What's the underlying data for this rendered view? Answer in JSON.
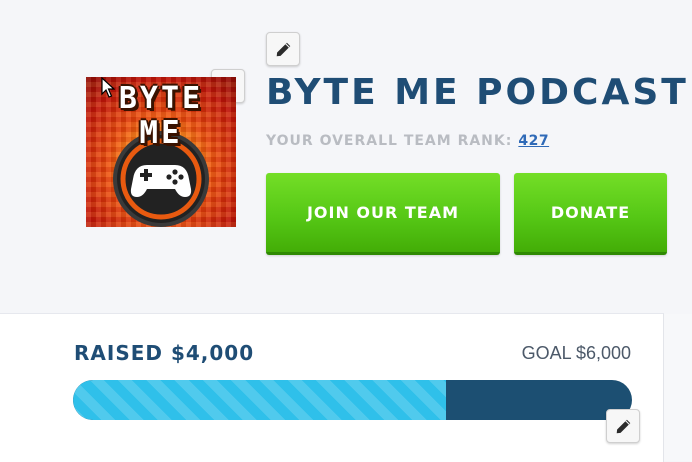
{
  "team": {
    "logo_text": [
      "BYTE",
      "ME"
    ],
    "name": "BYTE ME PODCAST",
    "rank_label": "YOUR OVERALL TEAM RANK:",
    "rank_value": "427"
  },
  "actions": {
    "join_label": "JOIN OUR TEAM",
    "donate_label": "DONATE"
  },
  "fundraising": {
    "raised_label": "RAISED $4,000",
    "goal_label": "GOAL $6,000",
    "raised_amount": 4000,
    "goal_amount": 6000,
    "progress_fraction": 0.667
  },
  "icons": {
    "edit": "pencil-icon",
    "logo_emblem": "gamepad-icon"
  },
  "colors": {
    "brand_blue": "#1f4d75",
    "button_green": "#56c816",
    "progress_fill": "#2fc0ea",
    "progress_track": "#1c4f72",
    "rank_link": "#2f6ab7"
  }
}
